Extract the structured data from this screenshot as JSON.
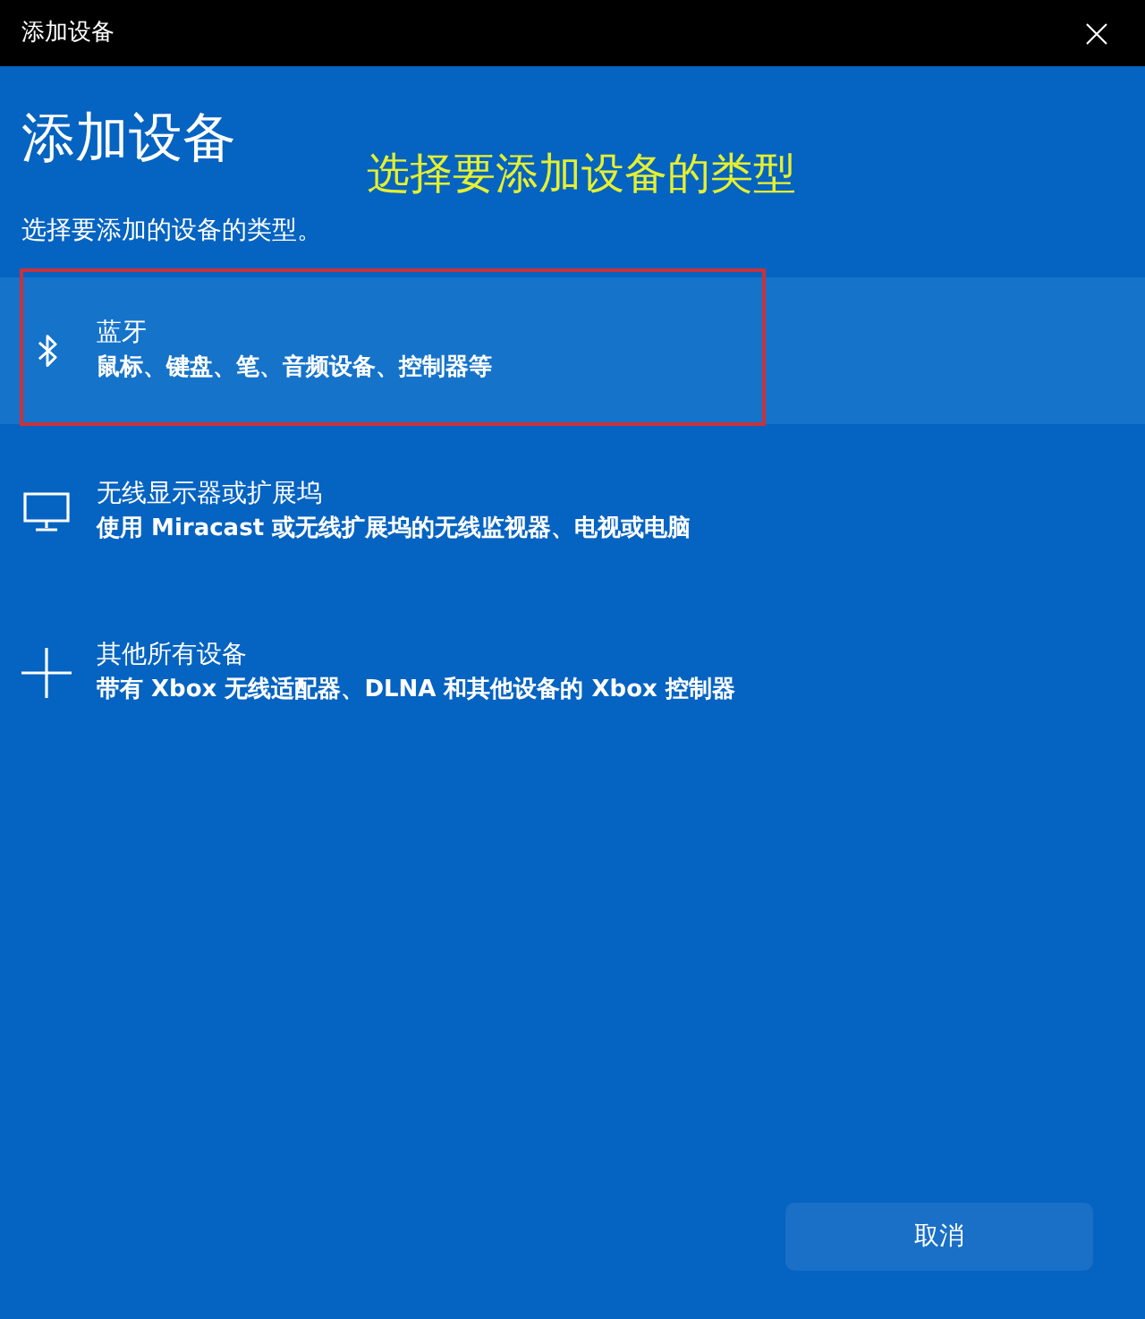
{
  "window": {
    "title": "添加设备"
  },
  "heading": "添加设备",
  "annotation": {
    "text": "选择要添加设备的类型"
  },
  "subtitle": "选择要添加的设备的类型。",
  "device_types": [
    {
      "kind": "bluetooth",
      "title": "蓝牙",
      "description": "鼠标、键盘、笔、音频设备、控制器等",
      "hovered": true,
      "highlighted": true
    },
    {
      "kind": "display",
      "title": "无线显示器或扩展坞",
      "description": "使用 Miracast 或无线扩展坞的无线监视器、电视或电脑",
      "hovered": false,
      "highlighted": false
    },
    {
      "kind": "other",
      "title": "其他所有设备",
      "description": "带有 Xbox 无线适配器、DLNA 和其他设备的 Xbox 控制器",
      "hovered": false,
      "highlighted": false
    }
  ],
  "buttons": [
    {
      "label": "取消"
    }
  ]
}
